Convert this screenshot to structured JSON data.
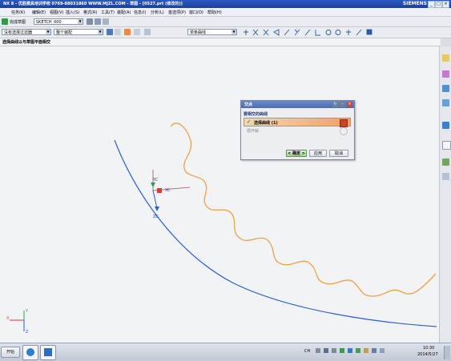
{
  "window": {
    "title": "NX 8 - 优胜模具培训学校  0769-88031860  WWW.MJZL.COM - 草图 - [0527.prt (修改的)]",
    "brand": "SIEMENS",
    "controls": [
      "_",
      "□",
      "×"
    ]
  },
  "menubar": [
    "任务(K)",
    "编辑(E)",
    "视图(V)",
    "插入(S)",
    "格式(R)",
    "工具(T)",
    "装配(A)",
    "信息(I)",
    "分析(L)",
    "首选项(P)",
    "窗口(O)",
    "帮助(H)"
  ],
  "toolbar1": {
    "finish_sketch_label": "完成草图",
    "sketch_name": "SKETCH_000"
  },
  "toolbar2": {
    "filter_value": "没有选择过滤器",
    "scope_value": "整个装配",
    "curve_rule_value": "单条曲线"
  },
  "cue_line": "选择曲线以与草图平面相交",
  "dialog": {
    "title": "交点",
    "section_title": "要相交的曲线",
    "select_curve_label": "选择曲线 (1)",
    "cycle_label": "循环解",
    "ok_label": "< 确定 >",
    "apply_label": "应用",
    "cancel_label": "取消"
  },
  "canvas_labels": {
    "csys_y": "YC",
    "csys_x": "XC",
    "csys_z": "ZC",
    "wcs_y": "Y",
    "wcs_z": "Z",
    "wcs_x": "X"
  },
  "taskbar": {
    "start_label": "开始",
    "ime_label": "CH",
    "time": "10:30",
    "date": "2014/5/27"
  },
  "colors": {
    "blue_curve": "#2a5fd6",
    "orange_spline": "#f0a04b",
    "title_bar": "#2b59c3"
  }
}
